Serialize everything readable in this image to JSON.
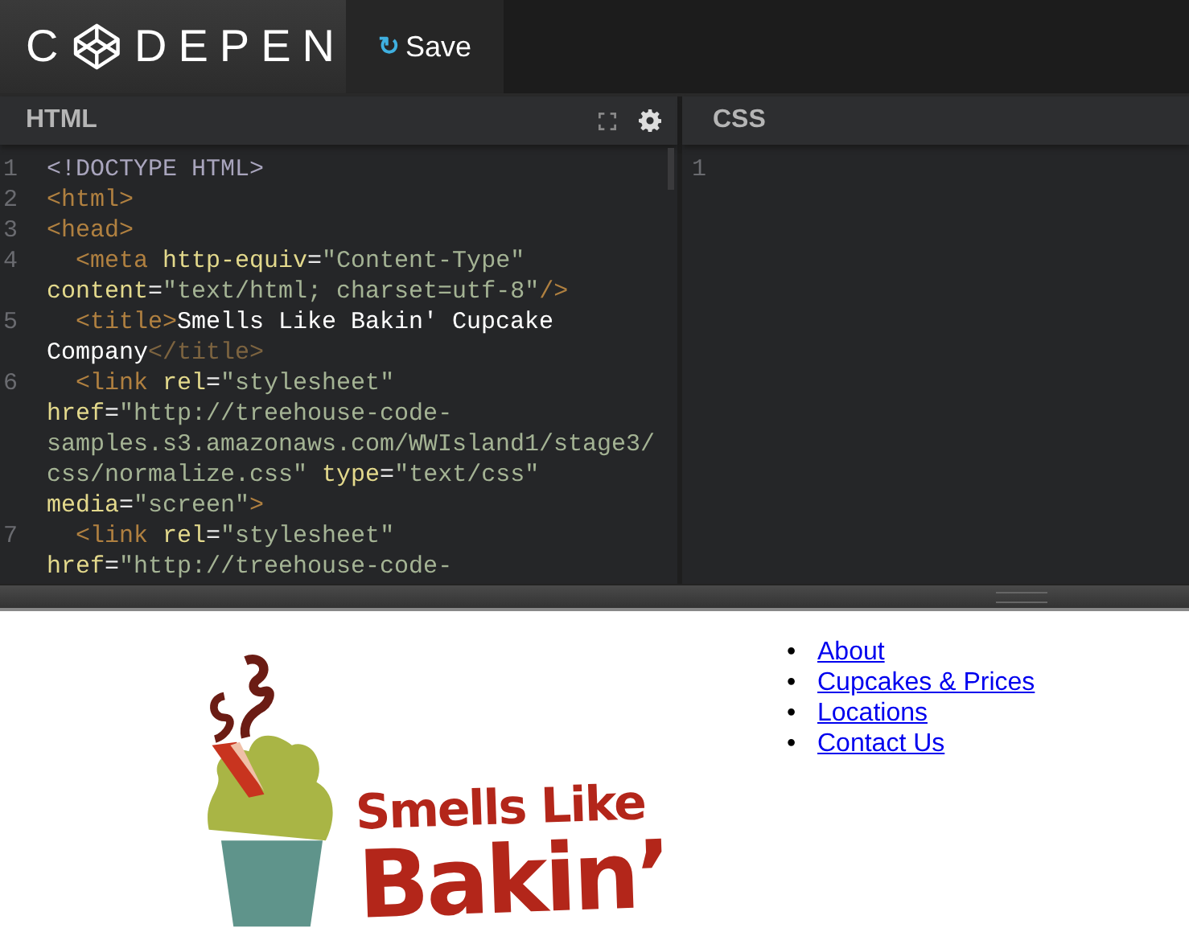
{
  "header": {
    "logo": {
      "before": "C",
      "after": "DEPEN"
    },
    "save_button": {
      "icon": "↻",
      "label": "Save"
    }
  },
  "editors": [
    {
      "kind": "html",
      "title": "HTML",
      "lines": [
        {
          "number": "1",
          "rows": [
            {
              "tokens": [
                {
                  "kind": "doctype",
                  "text": "<!DOCTYPE HTML>"
                }
              ]
            }
          ]
        },
        {
          "number": "2",
          "rows": [
            {
              "tokens": [
                {
                  "kind": "tag",
                  "text": "<html>"
                }
              ]
            }
          ]
        },
        {
          "number": "3",
          "rows": [
            {
              "tokens": [
                {
                  "kind": "tag",
                  "text": "<head>"
                }
              ]
            }
          ]
        },
        {
          "number": "4",
          "rows": [
            {
              "tokens": [
                {
                  "kind": "tag",
                  "text": "  <meta "
                },
                {
                  "kind": "attr",
                  "text": "http-equiv"
                },
                {
                  "kind": "punct",
                  "text": "="
                },
                {
                  "kind": "value",
                  "text": "\"Content-Type\""
                }
              ]
            },
            {
              "tokens": [
                {
                  "kind": "attr",
                  "text": "content"
                },
                {
                  "kind": "punct",
                  "text": "="
                },
                {
                  "kind": "value",
                  "text": "\"text/html; charset=utf-8\""
                },
                {
                  "kind": "tag",
                  "text": "/>"
                }
              ]
            }
          ]
        },
        {
          "number": "5",
          "rows": [
            {
              "tokens": [
                {
                  "kind": "tag",
                  "text": "  <title>"
                },
                {
                  "kind": "text",
                  "text": "Smells Like Bakin' Cupcake"
                }
              ]
            },
            {
              "tokens": [
                {
                  "kind": "text",
                  "text": "Company"
                },
                {
                  "kind": "closetag",
                  "text": "</title>"
                }
              ]
            }
          ]
        },
        {
          "number": "6",
          "rows": [
            {
              "tokens": [
                {
                  "kind": "tag",
                  "text": "  <link "
                },
                {
                  "kind": "attr",
                  "text": "rel"
                },
                {
                  "kind": "punct",
                  "text": "="
                },
                {
                  "kind": "value",
                  "text": "\"stylesheet\""
                }
              ]
            },
            {
              "tokens": [
                {
                  "kind": "attr",
                  "text": "href"
                },
                {
                  "kind": "punct",
                  "text": "="
                },
                {
                  "kind": "value",
                  "text": "\"http://treehouse-code-"
                }
              ]
            },
            {
              "tokens": [
                {
                  "kind": "value",
                  "text": "samples.s3.amazonaws.com/WWIsland1/stage3/"
                }
              ]
            },
            {
              "tokens": [
                {
                  "kind": "value",
                  "text": "css/normalize.css\" "
                },
                {
                  "kind": "attr",
                  "text": "type"
                },
                {
                  "kind": "punct",
                  "text": "="
                },
                {
                  "kind": "value",
                  "text": "\"text/css\""
                }
              ]
            },
            {
              "tokens": [
                {
                  "kind": "attr",
                  "text": "media"
                },
                {
                  "kind": "punct",
                  "text": "="
                },
                {
                  "kind": "value",
                  "text": "\"screen\""
                },
                {
                  "kind": "tag",
                  "text": ">"
                }
              ]
            }
          ]
        },
        {
          "number": "7",
          "rows": [
            {
              "tokens": [
                {
                  "kind": "tag",
                  "text": "  <link "
                },
                {
                  "kind": "attr",
                  "text": "rel"
                },
                {
                  "kind": "punct",
                  "text": "="
                },
                {
                  "kind": "value",
                  "text": "\"stylesheet\""
                }
              ]
            },
            {
              "tokens": [
                {
                  "kind": "attr",
                  "text": "href"
                },
                {
                  "kind": "punct",
                  "text": "="
                },
                {
                  "kind": "value",
                  "text": "\"http://treehouse-code-"
                }
              ]
            }
          ]
        }
      ]
    },
    {
      "kind": "css",
      "title": "CSS",
      "lines": [
        {
          "number": "1"
        }
      ]
    }
  ],
  "preview": {
    "logo_lines": [
      "Smells Like",
      "Bakin’"
    ],
    "nav": [
      {
        "marker": "•",
        "label": "About"
      },
      {
        "marker": "•",
        "label": "Cupcakes & Prices"
      },
      {
        "marker": "•",
        "label": "Locations"
      },
      {
        "marker": "•",
        "label": "Contact Us"
      }
    ]
  }
}
